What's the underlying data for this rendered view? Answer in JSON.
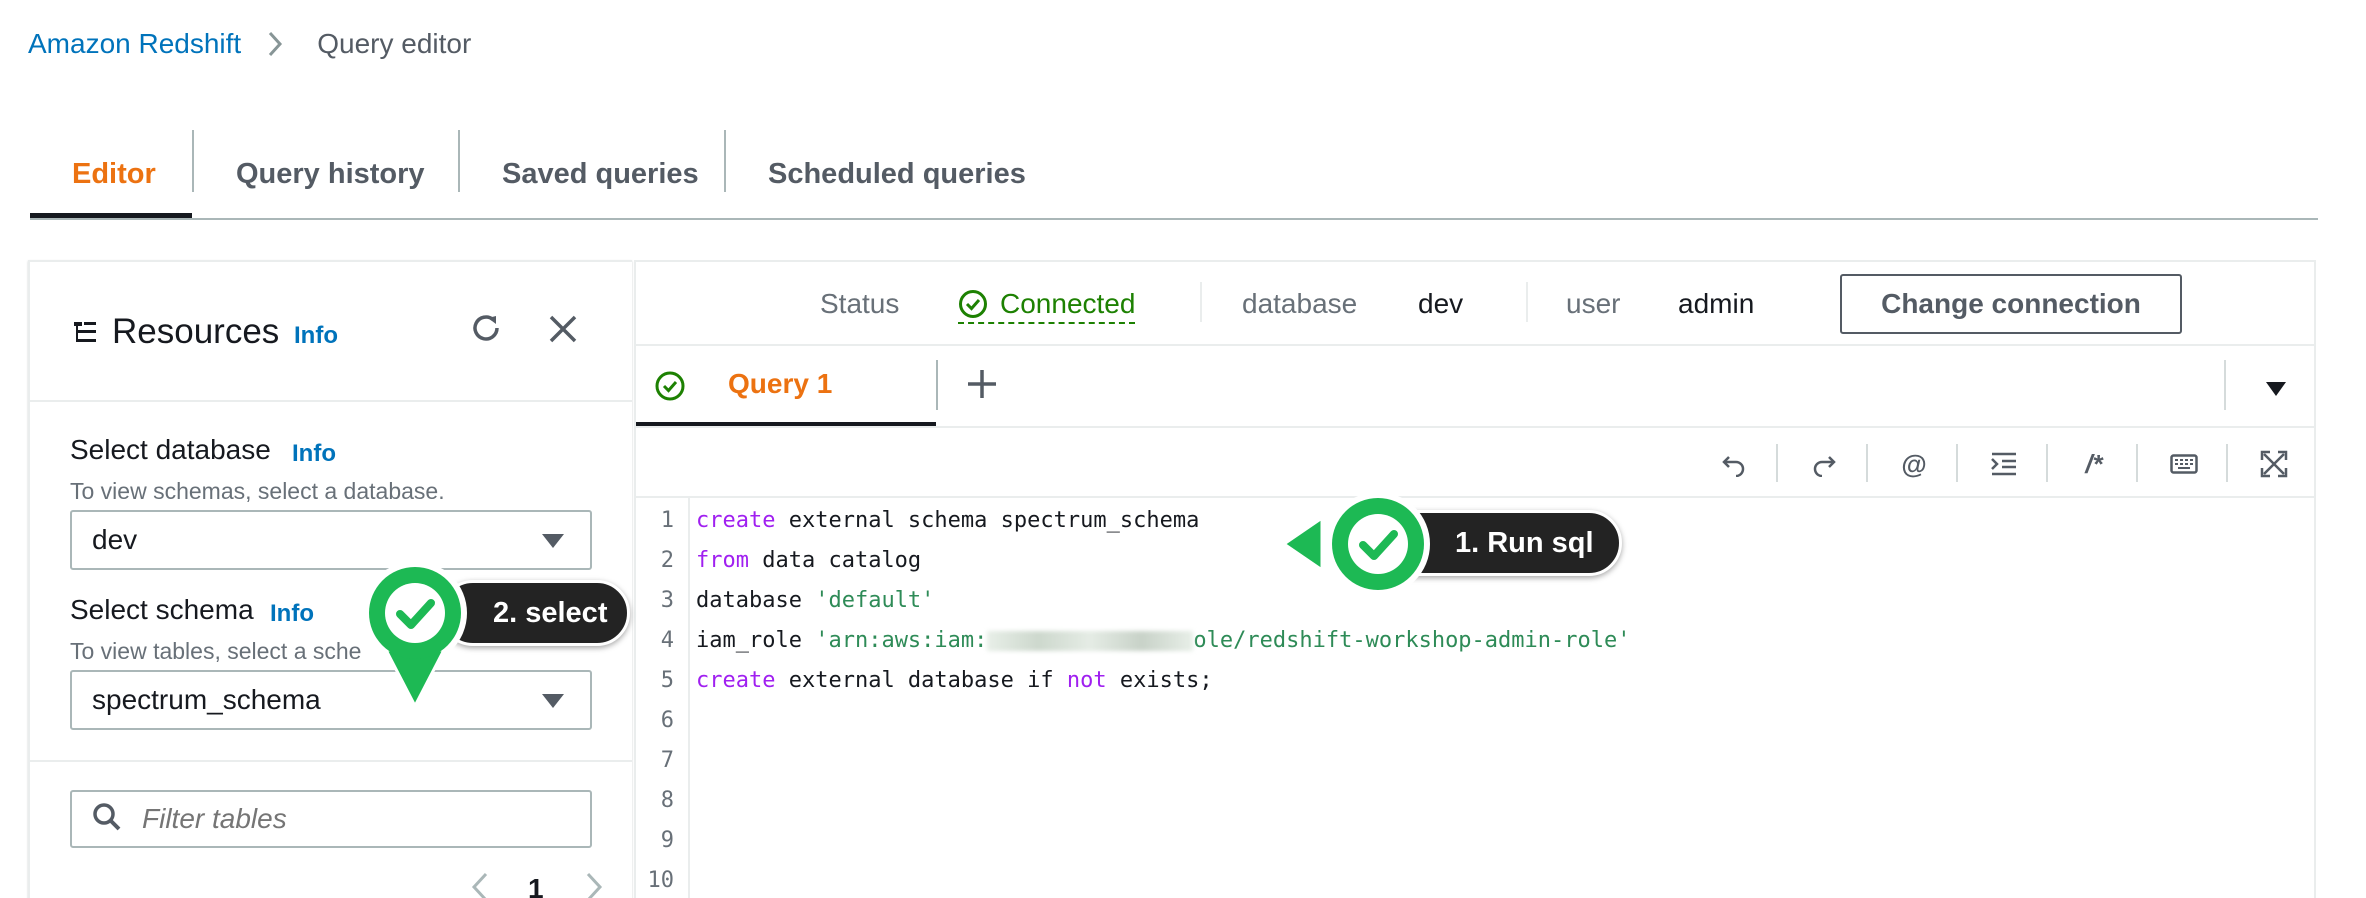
{
  "breadcrumb": {
    "root": "Amazon Redshift",
    "current": "Query editor"
  },
  "tabs": [
    {
      "label": "Editor",
      "active": true
    },
    {
      "label": "Query history",
      "active": false
    },
    {
      "label": "Saved queries",
      "active": false
    },
    {
      "label": "Scheduled queries",
      "active": false
    }
  ],
  "resources": {
    "title": "Resources",
    "info": "Info",
    "database": {
      "label": "Select database",
      "info": "Info",
      "description": "To view schemas, select a database.",
      "value": "dev"
    },
    "schema": {
      "label": "Select schema",
      "info": "Info",
      "description": "To view tables, select a sche",
      "value": "spectrum_schema"
    },
    "filter_placeholder": "Filter tables",
    "page": "1"
  },
  "status": {
    "status_label": "Status",
    "status_value": "Connected",
    "database_label": "database",
    "database_value": "dev",
    "user_label": "user",
    "user_value": "admin",
    "change_button": "Change connection"
  },
  "query_tab": {
    "label": "Query 1"
  },
  "toolbar": {
    "undo": "undo-icon",
    "redo": "redo-icon",
    "at": "@",
    "indent": "indent-icon",
    "comment": "/*",
    "keyboard": "keyboard-icon",
    "fullscreen": "fullscreen-icon"
  },
  "code": {
    "line_numbers": [
      "1",
      "2",
      "3",
      "4",
      "5",
      "6",
      "7",
      "8",
      "9",
      "10"
    ],
    "l1_kw": "create",
    "l1_rest": " external schema spectrum_schema",
    "l2_kw": "from",
    "l2_rest": " data catalog",
    "l3_plain": "database ",
    "l3_str": "'default'",
    "l4_plain": "iam_role ",
    "l4_str_a": "'arn:aws:iam:",
    "l4_str_b": "ole/redshift-workshop-admin-role'",
    "l5_kw1": "create",
    "l5_mid": " external database if ",
    "l5_kw2": "not",
    "l5_end": " exists;"
  },
  "callouts": {
    "run": "1. Run sql",
    "select": "2. select"
  },
  "colors": {
    "accent_orange": "#ec7211",
    "link_blue": "#0073bb",
    "success_green": "#1d8102",
    "callout_green": "#1db954"
  }
}
